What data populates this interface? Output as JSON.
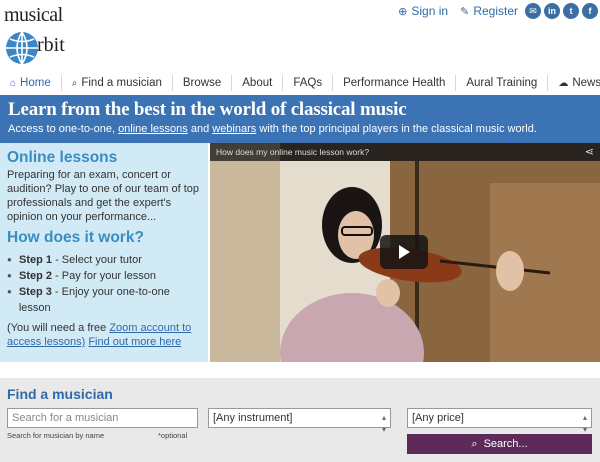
{
  "brand": {
    "logo_line1": "musical",
    "logo_line2": "rbit"
  },
  "toplinks": {
    "signin": "Sign in",
    "register": "Register"
  },
  "socials": [
    "email-icon",
    "linkedin-icon",
    "twitter-icon",
    "facebook-icon"
  ],
  "nav": {
    "items": [
      {
        "label": "Home",
        "icon": "home-icon"
      },
      {
        "label": "Find a musician",
        "icon": "search-icon"
      },
      {
        "label": "Browse"
      },
      {
        "label": "About"
      },
      {
        "label": "FAQs"
      },
      {
        "label": "Performance Health"
      },
      {
        "label": "Aural Training"
      },
      {
        "label": "News",
        "icon": "chat-icon"
      }
    ]
  },
  "banner": {
    "title": "Learn from the best in the world of classical music",
    "sub_before": "Access to one-to-one, ",
    "sub_link1": "online lessons",
    "sub_mid": " and ",
    "sub_link2": "webinars",
    "sub_after": " with the top principal players in the classical music world."
  },
  "panel": {
    "title": "Online lessons",
    "intro": "Preparing for an exam, concert or audition? Play to one of our team of top professionals and get the expert's opinion on your performance...",
    "how_title": "How does it work?",
    "steps": [
      {
        "step": "Step 1",
        "text": " - Select your tutor"
      },
      {
        "step": "Step 2",
        "text": " - Pay for your lesson"
      },
      {
        "step": "Step 3",
        "text": " - Enjoy your one-to-one lesson"
      }
    ],
    "note_before": "(You will need a free ",
    "note_link1": "Zoom account to access lessons)",
    "note_link2": "Find out more here"
  },
  "video": {
    "title": "How does my online music lesson work?"
  },
  "find": {
    "title": "Find a musician",
    "search_placeholder": "Search for a musician",
    "instrument": "[Any instrument]",
    "price": "[Any price]",
    "hint1": "Search for musician by name",
    "hint2": "*optional",
    "button": "Search..."
  },
  "colors": {
    "accent": "#3c73b4",
    "panel_bg": "#d2eaf6",
    "button": "#5e2a5a"
  }
}
